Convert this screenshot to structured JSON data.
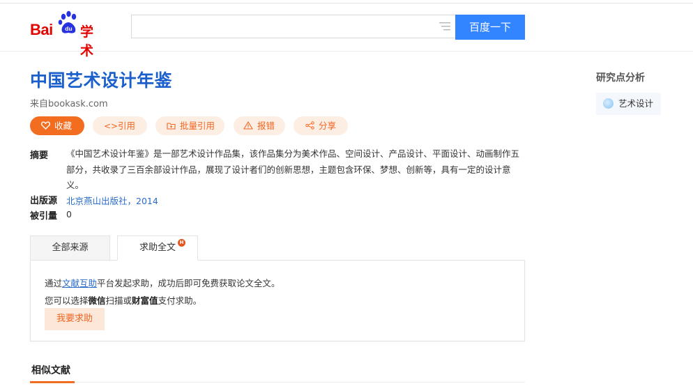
{
  "header": {
    "logo_text_bai": "Bai",
    "logo_text_du": "du",
    "logo_text_xueshu": "学术",
    "search_value": "",
    "search_button": "百度一下"
  },
  "paper": {
    "title": "中国艺术设计年鉴",
    "source": "来自bookask.com"
  },
  "actions": {
    "collect": "收藏",
    "cite": "引用",
    "batch_cite": "批量引用",
    "report": "报错",
    "share": "分享"
  },
  "meta": {
    "abstract_label": "摘要",
    "abstract": "《中国艺术设计年鉴》是一部艺术设计作品集，该作品集分为美术作品、空间设计、产品设计、平面设计、动画制作五部分，共收录了三百余部设计作品，展现了设计者们的创新思想，主题包含环保、梦想、创新等，具有一定的设计意义。",
    "publisher_label": "出版源",
    "publisher": "北京燕山出版社，2014",
    "cited_label": "被引量",
    "cited": "0"
  },
  "tabs": {
    "all_sources": "全部来源",
    "request_fulltext": "求助全文",
    "badge": "H"
  },
  "help_panel": {
    "line1_pre": "通过",
    "line1_link": "文献互助",
    "line1_post": "平台发起求助，成功后即可免费获取论文全文。",
    "line2_pre": "您可以选择",
    "line2_wechat": "微信",
    "line2_mid": "扫描或",
    "line2_wealth": "财富值",
    "line2_post": "支付求助。",
    "button": "我要求助"
  },
  "similar": {
    "title": "相似文献"
  },
  "sidebar": {
    "title": "研究点分析",
    "tag": "艺术设计"
  },
  "colors": {
    "accent_orange": "#f36d21",
    "link_blue": "#2a6cc8",
    "title_blue": "#1a5fcc",
    "search_blue": "#3385ff"
  }
}
